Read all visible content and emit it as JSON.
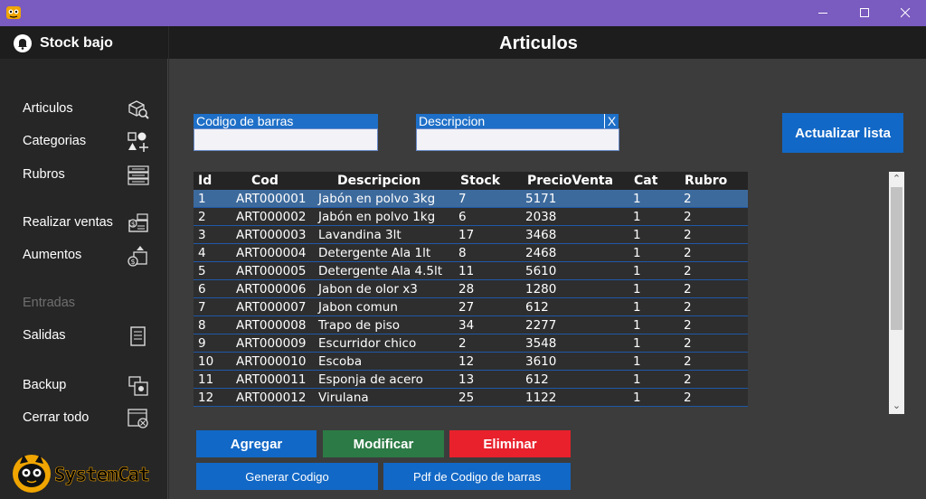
{
  "window": {
    "minimize": "—",
    "maximize": "☐",
    "close": "✕"
  },
  "sidebar": {
    "header": "Stock bajo",
    "items": [
      {
        "label": "Articulos",
        "icon": "box-search-icon",
        "enabled": true
      },
      {
        "label": "Categorias",
        "icon": "shapes-add-icon",
        "enabled": true
      },
      {
        "label": "Rubros",
        "icon": "list-icon",
        "enabled": true
      },
      {
        "label": "Realizar ventas",
        "icon": "cash-register-icon",
        "enabled": true
      },
      {
        "label": "Aumentos",
        "icon": "price-up-icon",
        "enabled": true
      },
      {
        "label": "Entradas",
        "icon": "",
        "enabled": false
      },
      {
        "label": "Salidas",
        "icon": "document-icon",
        "enabled": true
      },
      {
        "label": "Backup",
        "icon": "backup-icon",
        "enabled": true
      },
      {
        "label": "Cerrar todo",
        "icon": "close-window-icon",
        "enabled": true
      }
    ],
    "logo_text": "SystemCat"
  },
  "main": {
    "title": "Articulos",
    "filters": {
      "barcode_label": "Codigo de barras",
      "barcode_value": "",
      "description_label": "Descripcion",
      "description_value": "",
      "clear": "X"
    },
    "refresh_button": "Actualizar lista",
    "table": {
      "columns": [
        "Id",
        "Cod",
        "Descripcion",
        "Stock",
        "PrecioVenta",
        "Cat",
        "Rubro"
      ],
      "rows": [
        [
          "1",
          "ART000001",
          "Jabón en polvo 3kg",
          "7",
          "5171",
          "1",
          "2"
        ],
        [
          "2",
          "ART000002",
          "Jabón en polvo 1kg",
          "6",
          "2038",
          "1",
          "2"
        ],
        [
          "3",
          "ART000003",
          "Lavandina 3lt",
          "17",
          "3468",
          "1",
          "2"
        ],
        [
          "4",
          "ART000004",
          "Detergente Ala 1lt",
          "8",
          "2468",
          "1",
          "2"
        ],
        [
          "5",
          "ART000005",
          "Detergente Ala 4.5lt",
          "11",
          "5610",
          "1",
          "2"
        ],
        [
          "6",
          "ART000006",
          "Jabon de olor x3",
          "28",
          "1280",
          "1",
          "2"
        ],
        [
          "7",
          "ART000007",
          "Jabon comun",
          "27",
          "612",
          "1",
          "2"
        ],
        [
          "8",
          "ART000008",
          "Trapo de piso",
          "34",
          "2277",
          "1",
          "2"
        ],
        [
          "9",
          "ART000009",
          "Escurridor chico",
          "2",
          "3548",
          "1",
          "2"
        ],
        [
          "10",
          "ART000010",
          "Escoba",
          "12",
          "3610",
          "1",
          "2"
        ],
        [
          "11",
          "ART000011",
          "Esponja de acero",
          "13",
          "612",
          "1",
          "2"
        ],
        [
          "12",
          "ART000012",
          "Virulana",
          "25",
          "1122",
          "1",
          "2"
        ]
      ],
      "selected_row": 0
    },
    "buttons": {
      "add": "Agregar",
      "edit": "Modificar",
      "delete": "Eliminar",
      "generate_code": "Generar Codigo",
      "barcode_pdf": "Pdf de Codigo de barras"
    }
  },
  "colors": {
    "titlebar": "#7a5bbf",
    "accent_blue": "#1268c6",
    "green": "#2c7a45",
    "red": "#e8212c",
    "selected_row": "#3d6a9c"
  }
}
